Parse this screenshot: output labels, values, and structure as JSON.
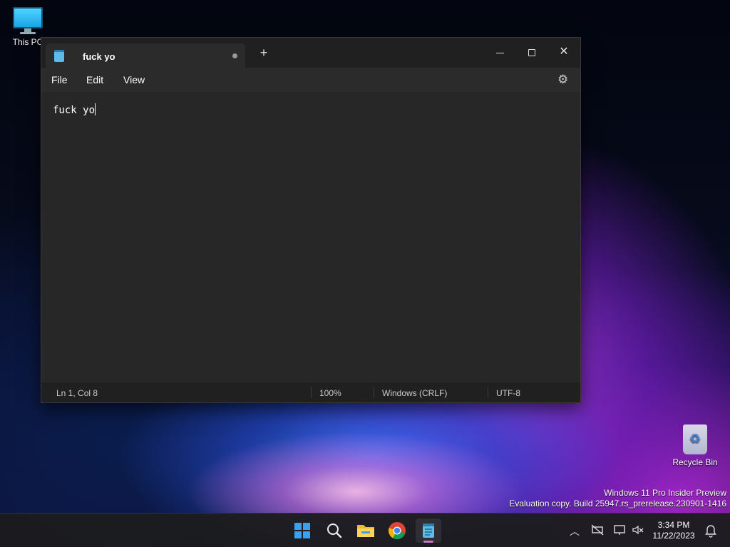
{
  "desktop": {
    "icons": [
      {
        "label": "This PC"
      },
      {
        "label": "Recycle Bin"
      }
    ],
    "watermark": {
      "line1": "Windows 11 Pro Insider Preview",
      "line2": "Evaluation copy. Build 25947.rs_prerelease.230901-1416"
    }
  },
  "notepad": {
    "tab_title": "fuck yo",
    "new_tab_label": "+",
    "menu": {
      "file": "File",
      "edit": "Edit",
      "view": "View"
    },
    "content": "fuck yo",
    "status": {
      "position": "Ln 1, Col 8",
      "zoom": "100%",
      "line_ending": "Windows (CRLF)",
      "encoding": "UTF-8"
    }
  },
  "taskbar": {
    "apps": [
      "start-icon",
      "search-icon",
      "file-explorer-icon",
      "chrome-icon",
      "notepad-icon"
    ],
    "clock": {
      "time": "3:34 PM",
      "date": "11/22/2023"
    }
  },
  "colors": {
    "accent": "#3aa0f0",
    "window_bg": "#272727",
    "titlebar_bg": "#202020"
  }
}
